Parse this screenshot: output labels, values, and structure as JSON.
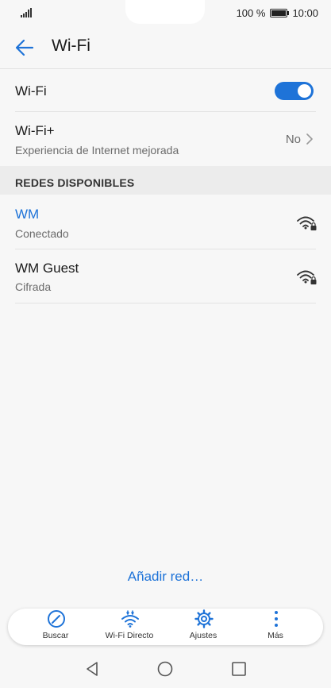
{
  "status_bar": {
    "battery_text": "100 %",
    "time": "10:00"
  },
  "toolbar": {
    "title": "Wi-Fi",
    "back_icon": "arrow-left-icon"
  },
  "wifi_toggle": {
    "label": "Wi-Fi",
    "state": "on",
    "accent": "#1e73d8"
  },
  "wifi_plus": {
    "label": "Wi-Fi+",
    "description": "Experiencia de Internet mejorada",
    "value": "No"
  },
  "available_networks": {
    "header": "REDES DISPONIBLES",
    "items": [
      {
        "name": "WM",
        "status": "Conectado",
        "connected": true,
        "icon": "wifi-lock-icon"
      },
      {
        "name": "WM Guest",
        "status": "Cifrada",
        "connected": false,
        "icon": "wifi-lock-icon"
      }
    ]
  },
  "add_network_label": "Añadir red…",
  "bottom_nav": {
    "items": [
      {
        "label": "Buscar",
        "icon": "scan-icon"
      },
      {
        "label": "Wi-Fi Directo",
        "icon": "wifi-direct-icon"
      },
      {
        "label": "Ajustes",
        "icon": "gear-icon"
      },
      {
        "label": "Más",
        "icon": "more-vertical-icon"
      }
    ]
  },
  "colors": {
    "accent": "#1e73d8",
    "background": "#f7f7f7",
    "section_bg": "#ececec"
  }
}
